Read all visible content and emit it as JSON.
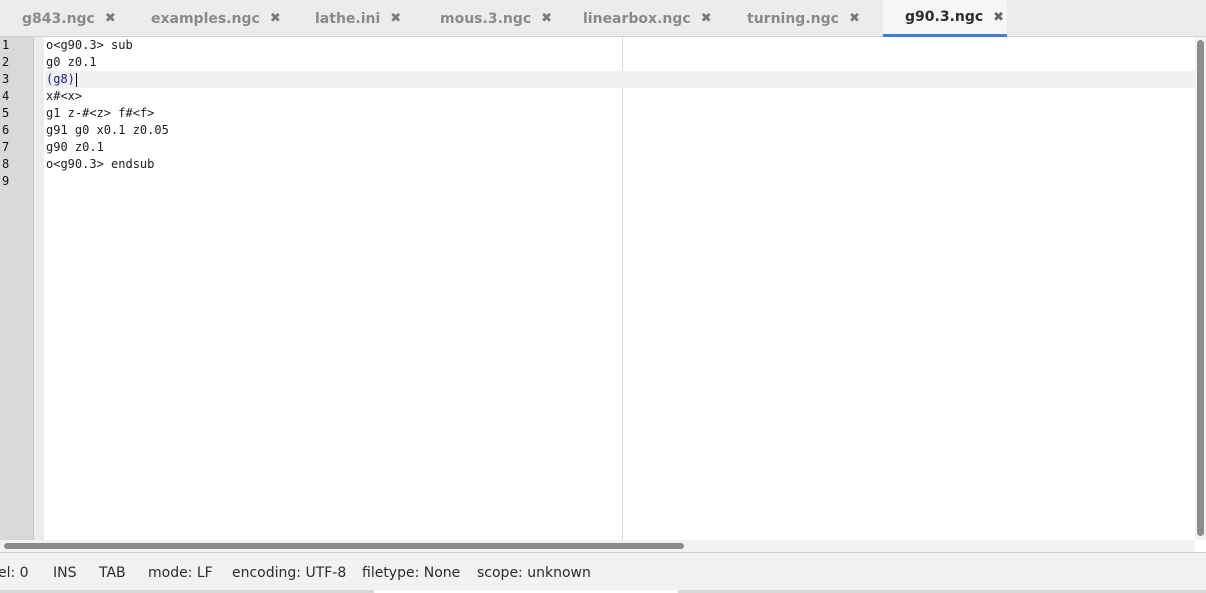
{
  "tabs": [
    {
      "label": "g843.ngc",
      "active": false
    },
    {
      "label": "examples.ngc",
      "active": false
    },
    {
      "label": "lathe.ini",
      "active": false
    },
    {
      "label": "mous.3.ngc",
      "active": false
    },
    {
      "label": "linearbox.ngc",
      "active": false
    },
    {
      "label": "turning.ngc",
      "active": false
    },
    {
      "label": "g90.3.ngc",
      "active": true
    }
  ],
  "tab_close_glyph": "✖",
  "accent_color": "#3b7dd8",
  "editor": {
    "line_numbers": [
      "1",
      "2",
      "3",
      "4",
      "5",
      "6",
      "7",
      "8",
      "9"
    ],
    "lines": [
      {
        "text": "o<g90.3> sub"
      },
      {
        "text": "g0 z0.1"
      },
      {
        "text": "(g8)",
        "comment": true,
        "current": true
      },
      {
        "text": "x#<x>"
      },
      {
        "text": "g1 z-#<z> f#<f>"
      },
      {
        "text": "g91 g0 x0.1 z0.05"
      },
      {
        "text": "g90 z0.1"
      },
      {
        "text": "o<g90.3> endsub"
      },
      {
        "text": ""
      }
    ]
  },
  "status": {
    "sel": "el: 0",
    "mode_ins": "INS",
    "indent": "TAB",
    "line_ending": "mode: LF",
    "encoding": "encoding: UTF-8",
    "filetype": "filetype: None",
    "scope": "scope: unknown"
  }
}
